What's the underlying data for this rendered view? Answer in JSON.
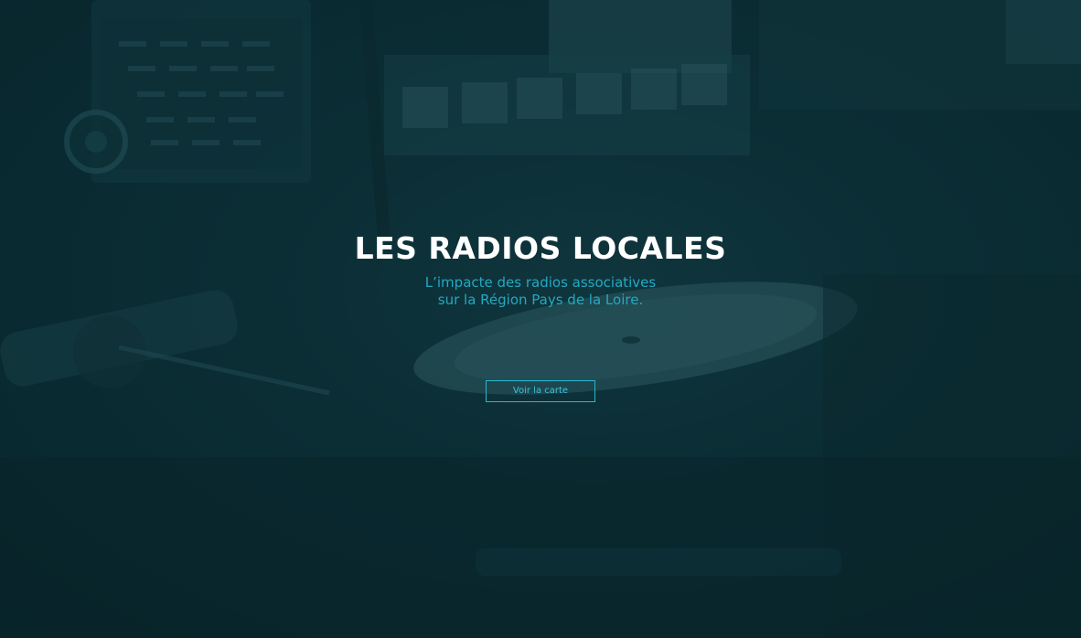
{
  "hero": {
    "title": "LES RADIOS LOCALES",
    "subtitle_line1": "L’impacte des radios associatives",
    "subtitle_line2": "sur la Région Pays de la Loire.",
    "cta_label": "Voir la carte"
  },
  "colors": {
    "overlay": "#0b2d35",
    "title": "#ffffff",
    "accent": "#24a8c2"
  },
  "background": {
    "image_icon": "radio-studio-turntable-photo"
  }
}
